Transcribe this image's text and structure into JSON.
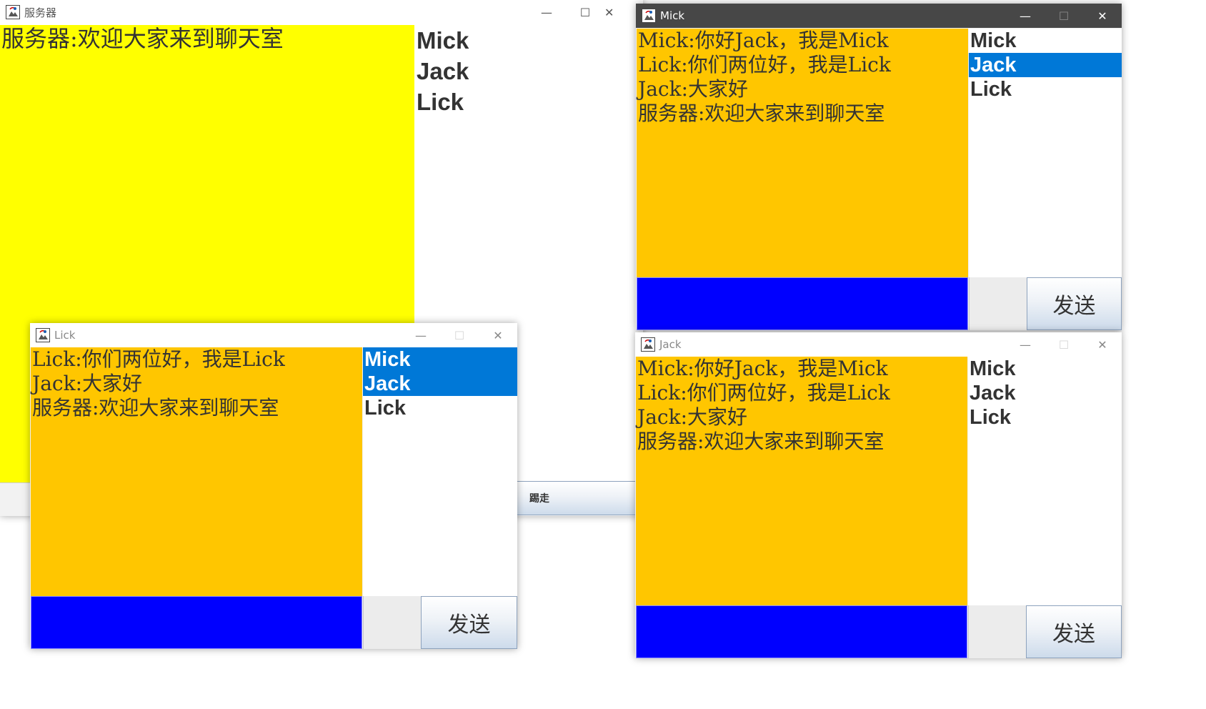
{
  "colors": {
    "server_chat_bg": "#ffff00",
    "client_chat_bg": "#ffc600",
    "input_bg": "#0000ff",
    "selection": "#0078d7"
  },
  "icons": {
    "app": "java-cup-icon",
    "minimize": "minimize-icon",
    "maximize": "maximize-icon",
    "close": "close-icon"
  },
  "server": {
    "title": "服务器",
    "messages": [
      "服务器:欢迎大家来到聊天室"
    ],
    "users": [
      "Mick",
      "Jack",
      "Lick"
    ],
    "kick_label": "踢走"
  },
  "mick": {
    "title": "Mick",
    "messages": [
      "Mick:你好Jack，我是Mick",
      "Lick:你们两位好，我是Lick",
      "Jack:大家好",
      "服务器:欢迎大家来到聊天室"
    ],
    "users": [
      "Mick",
      "Jack",
      "Lick"
    ],
    "input_value": "",
    "send_label": "发送"
  },
  "jack": {
    "title": "Jack",
    "messages": [
      "Mick:你好Jack，我是Mick",
      "Lick:你们两位好，我是Lick",
      "Jack:大家好",
      "服务器:欢迎大家来到聊天室"
    ],
    "users": [
      "Mick",
      "Jack",
      "Lick"
    ],
    "input_value": "",
    "send_label": "发送"
  },
  "lick": {
    "title": "Lick",
    "messages": [
      "Lick:你们两位好，我是Lick",
      "Jack:大家好",
      "服务器:欢迎大家来到聊天室"
    ],
    "users": [
      "Mick",
      "Jack",
      "Lick"
    ],
    "input_value": "",
    "send_label": "发送"
  }
}
